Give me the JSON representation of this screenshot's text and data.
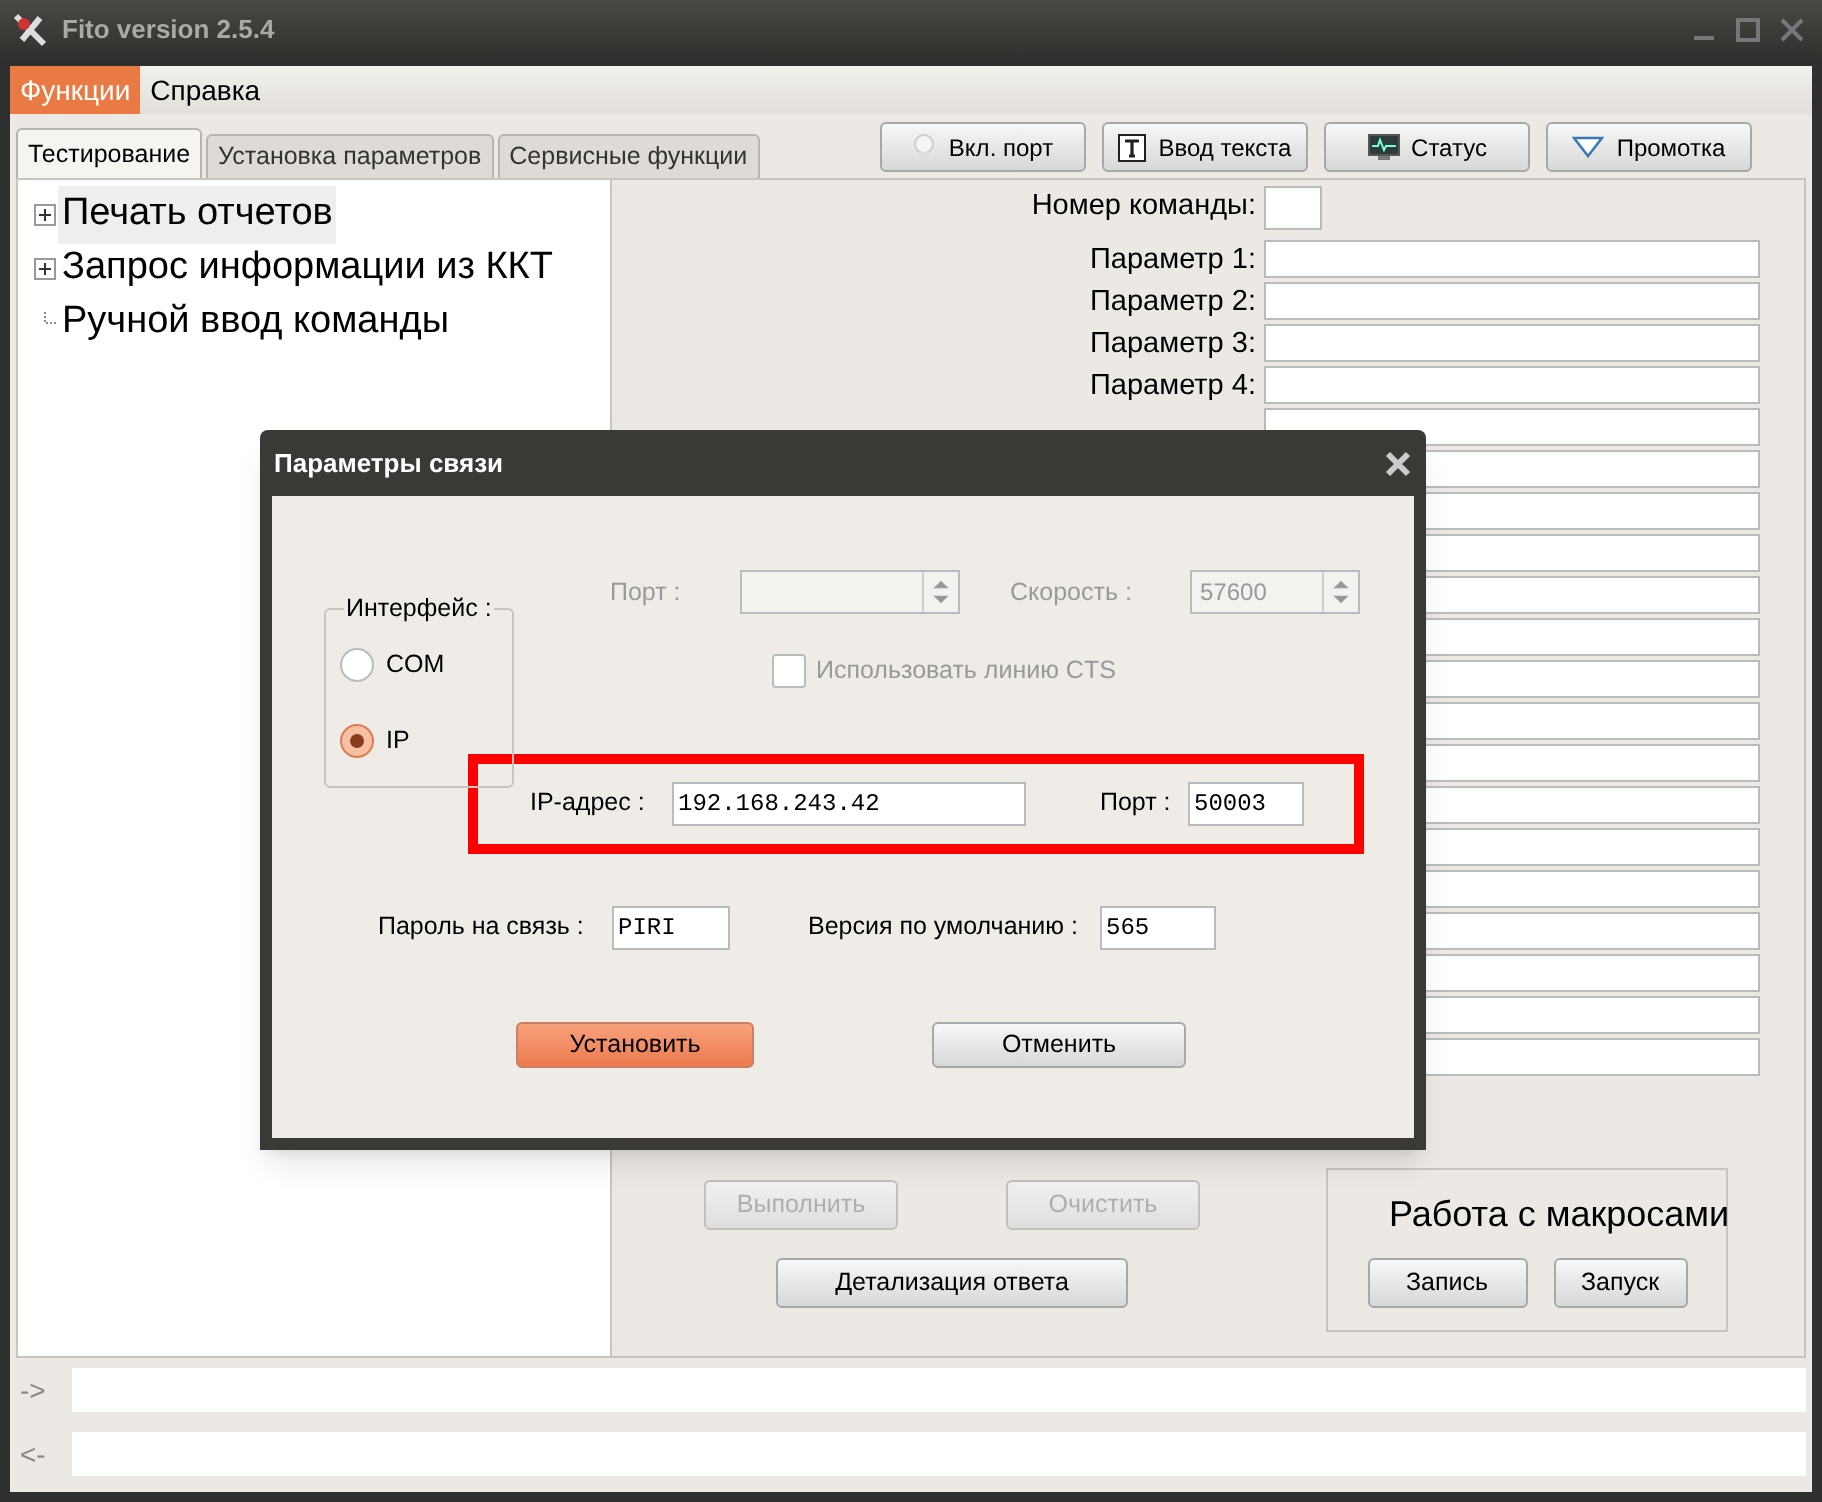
{
  "window": {
    "title": "Fito version 2.5.4"
  },
  "menu": [
    {
      "label": "Функции",
      "selected": true
    },
    {
      "label": "Справка",
      "selected": false
    }
  ],
  "tabs": [
    {
      "label": "Тестирование",
      "selected": true
    },
    {
      "label": "Установка параметров",
      "selected": false
    },
    {
      "label": "Сервисные функции",
      "selected": false
    }
  ],
  "toolbar": [
    {
      "label": "Вкл. порт"
    },
    {
      "label": "Ввод текста"
    },
    {
      "label": "Статус"
    },
    {
      "label": "Промотка"
    }
  ],
  "tree": [
    {
      "label": "Печать отчетов",
      "expandable": true,
      "selected": true
    },
    {
      "label": "Запрос информации из ККТ",
      "expandable": true,
      "selected": false
    },
    {
      "label": "Ручной ввод команды",
      "expandable": false,
      "selected": false
    }
  ],
  "command_number": {
    "label": "Номер команды:"
  },
  "parameters": [
    {
      "kind": "labeled",
      "label": "Параметр 1:"
    },
    {
      "kind": "labeled",
      "label": "Параметр 2:"
    },
    {
      "kind": "labeled",
      "label": "Параметр 3:"
    },
    {
      "kind": "labeled",
      "label": "Параметр 4:"
    },
    {
      "kind": "covered"
    },
    {
      "kind": "covered"
    },
    {
      "kind": "covered"
    },
    {
      "kind": "covered"
    },
    {
      "kind": "covered"
    },
    {
      "kind": "covered"
    },
    {
      "kind": "covered"
    },
    {
      "kind": "covered"
    },
    {
      "kind": "covered"
    },
    {
      "kind": "covered"
    },
    {
      "kind": "covered"
    },
    {
      "kind": "covered"
    },
    {
      "kind": "covered"
    },
    {
      "kind": "covered"
    },
    {
      "kind": "covered"
    },
    {
      "kind": "covered"
    }
  ],
  "actions": [
    {
      "label": "Выполнить",
      "disabled": true
    },
    {
      "label": "Очистить",
      "disabled": true
    }
  ],
  "detail_button": {
    "label": "Детализация ответа"
  },
  "macros": {
    "title": "Работа с макросами",
    "buttons": [
      {
        "label": "Запись"
      },
      {
        "label": "Запуск"
      }
    ]
  },
  "console": [
    {
      "prompt": "->"
    },
    {
      "prompt": "<-"
    }
  ],
  "dialog": {
    "title": "Параметры связи",
    "interface": {
      "title": "Интерфейс :",
      "options": [
        {
          "label": "COM",
          "selected": false
        },
        {
          "label": "IP",
          "selected": true
        }
      ]
    },
    "serial": {
      "disabled": true,
      "port_label": "Порт :",
      "speed_label": "Скорость :",
      "speed_value": "57600"
    },
    "cts": {
      "label": "Использовать линию CTS",
      "checked": false,
      "disabled": true
    },
    "ip": {
      "highlighted": true,
      "address_label": "IP-адрес :",
      "address_value": "192.168.243.42",
      "port_label": "Порт :",
      "port_value": "50003"
    },
    "password": {
      "label": "Пароль на связь :",
      "value": "PIRI"
    },
    "version": {
      "label": "Версия по умолчанию :",
      "value": "565"
    },
    "buttons": [
      {
        "label": "Установить",
        "primary": true
      },
      {
        "label": "Отменить",
        "primary": false
      }
    ]
  }
}
